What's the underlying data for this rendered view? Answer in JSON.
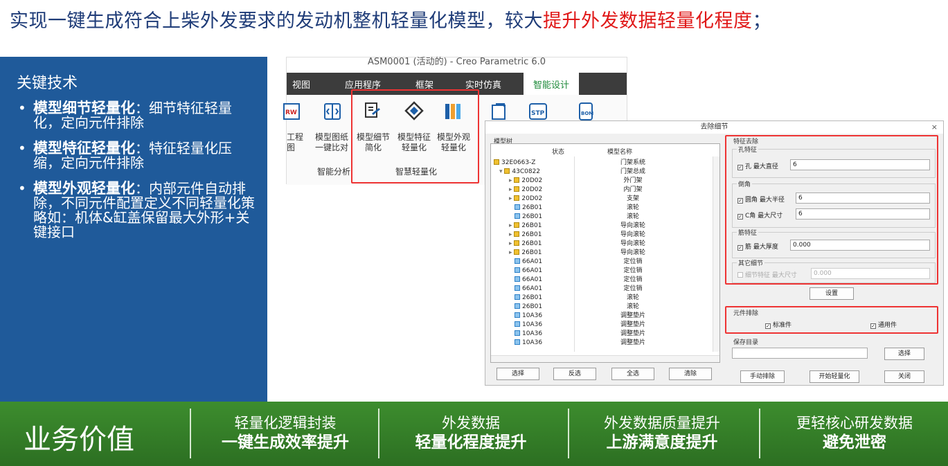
{
  "title": {
    "normal": "实现一键生成符合上柴外发要求的发动机整机轻量化模型，较大",
    "red": "提升外发数据轻量化程度",
    "end": "；"
  },
  "left": {
    "heading": "关键技术",
    "items": [
      {
        "bold": "模型细节轻量化",
        "text": "：细节特征轻量化，定向元件排除"
      },
      {
        "bold": "模型特征轻量化",
        "text": "：特征轻量化压缩，定向元件排除"
      },
      {
        "bold": "模型外观轻量化",
        "text": "：内部元件自动排除，不同元件配置定义不同轻量化策略如：机体&缸盖保留最大外形+关键接口"
      }
    ]
  },
  "creo": {
    "window_title": "ASM0001 (活动的) - Creo Parametric 6.0",
    "menu": [
      "视图",
      "应用程序",
      "框架",
      "实时仿真",
      "智能设计"
    ],
    "buttons": [
      "工程图",
      "模型图纸一键比对",
      "模型细节简化",
      "模型特征轻量化",
      "模型外观轻量化"
    ],
    "groups": [
      "智能分析",
      "智慧轻量化"
    ]
  },
  "dialog": {
    "title": "去除细节",
    "tree_label": "模型树",
    "col_status": "状态",
    "col_name": "模型名称",
    "rows": [
      {
        "id": "32E0663-Z",
        "name": "门架系统",
        "lvl": 0,
        "yellow": true
      },
      {
        "id": "43C0822",
        "name": "门架总成",
        "lvl": 1,
        "yellow": true,
        "open": true
      },
      {
        "id": "20D02",
        "name": "外门架",
        "lvl": 2,
        "yellow": true
      },
      {
        "id": "20D02",
        "name": "内门架",
        "lvl": 2,
        "yellow": true
      },
      {
        "id": "20D02",
        "name": "支架",
        "lvl": 2,
        "yellow": true
      },
      {
        "id": "26B01",
        "name": "滚轮",
        "lvl": 3
      },
      {
        "id": "26B01",
        "name": "滚轮",
        "lvl": 3
      },
      {
        "id": "26B01",
        "name": "导向滚轮",
        "lvl": 2,
        "yellow": true
      },
      {
        "id": "26B01",
        "name": "导向滚轮",
        "lvl": 2,
        "yellow": true
      },
      {
        "id": "26B01",
        "name": "导向滚轮",
        "lvl": 2,
        "yellow": true
      },
      {
        "id": "26B01",
        "name": "导向滚轮",
        "lvl": 2,
        "yellow": true
      },
      {
        "id": "66A01",
        "name": "定位销",
        "lvl": 3
      },
      {
        "id": "66A01",
        "name": "定位销",
        "lvl": 3
      },
      {
        "id": "66A01",
        "name": "定位销",
        "lvl": 3
      },
      {
        "id": "66A01",
        "name": "定位销",
        "lvl": 3
      },
      {
        "id": "26B01",
        "name": "滚轮",
        "lvl": 3
      },
      {
        "id": "26B01",
        "name": "滚轮",
        "lvl": 3
      },
      {
        "id": "10A36",
        "name": "调整垫片",
        "lvl": 3
      },
      {
        "id": "10A36",
        "name": "调整垫片",
        "lvl": 3
      },
      {
        "id": "10A36",
        "name": "调整垫片",
        "lvl": 3
      },
      {
        "id": "10A36",
        "name": "调整垫片",
        "lvl": 3
      }
    ],
    "tree_buttons": [
      "选择",
      "反选",
      "全选",
      "清除"
    ],
    "feature_group": "特征去除",
    "hole_group": "孔特征",
    "hole_label": "孔  最大直径",
    "hole_value": "6",
    "chamfer_group": "倒角",
    "round_label": "圆角  最大半径",
    "round_value": "6",
    "chamf_label": "C角  最大尺寸",
    "chamf_value": "6",
    "rib_group": "筋特征",
    "rib_label": "筋  最大厚度",
    "rib_value": "0.000",
    "other_group": "其它细节",
    "other_label": "细节特征  最大尺寸",
    "other_value": "0.000",
    "settings_btn": "设置",
    "exclude_group": "元件排除",
    "std_part": "标准件",
    "common_part": "通用件",
    "save_group": "保存目录",
    "select_btn": "选择",
    "bottom_buttons": [
      "手动排除",
      "开始轻量化",
      "关闭"
    ]
  },
  "bottom": {
    "value_label": "业务价值",
    "cells": [
      {
        "l1": "轻量化逻辑封装",
        "l2": "一键生成效率提升"
      },
      {
        "l1": "外发数据",
        "l2": "轻量化程度提升"
      },
      {
        "l1": "外发数据质量提升",
        "l2": "上游满意度提升"
      },
      {
        "l1": "更轻核心研发数据",
        "l2": "避免泄密"
      }
    ]
  }
}
